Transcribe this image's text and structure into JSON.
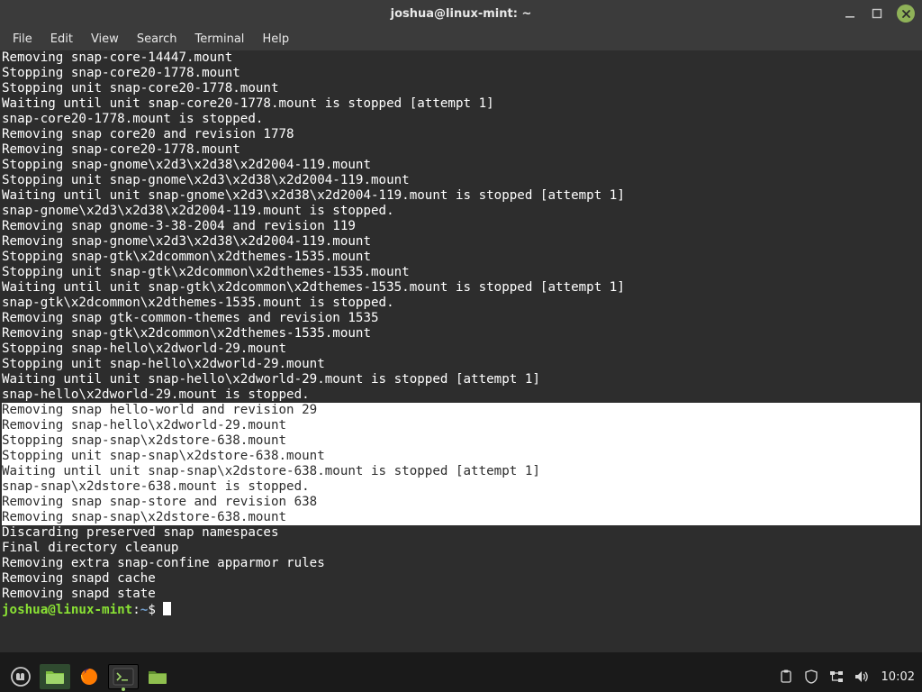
{
  "window": {
    "title": "joshua@linux-mint: ~"
  },
  "menubar": {
    "items": [
      "File",
      "Edit",
      "View",
      "Search",
      "Terminal",
      "Help"
    ]
  },
  "terminal": {
    "lines": [
      {
        "t": "Removing snap-core-14447.mount",
        "sel": false
      },
      {
        "t": "Stopping snap-core20-1778.mount",
        "sel": false
      },
      {
        "t": "Stopping unit snap-core20-1778.mount",
        "sel": false
      },
      {
        "t": "Waiting until unit snap-core20-1778.mount is stopped [attempt 1]",
        "sel": false
      },
      {
        "t": "snap-core20-1778.mount is stopped.",
        "sel": false
      },
      {
        "t": "Removing snap core20 and revision 1778",
        "sel": false
      },
      {
        "t": "Removing snap-core20-1778.mount",
        "sel": false
      },
      {
        "t": "Stopping snap-gnome\\x2d3\\x2d38\\x2d2004-119.mount",
        "sel": false
      },
      {
        "t": "Stopping unit snap-gnome\\x2d3\\x2d38\\x2d2004-119.mount",
        "sel": false
      },
      {
        "t": "Waiting until unit snap-gnome\\x2d3\\x2d38\\x2d2004-119.mount is stopped [attempt 1]",
        "sel": false
      },
      {
        "t": "snap-gnome\\x2d3\\x2d38\\x2d2004-119.mount is stopped.",
        "sel": false
      },
      {
        "t": "Removing snap gnome-3-38-2004 and revision 119",
        "sel": false
      },
      {
        "t": "Removing snap-gnome\\x2d3\\x2d38\\x2d2004-119.mount",
        "sel": false
      },
      {
        "t": "Stopping snap-gtk\\x2dcommon\\x2dthemes-1535.mount",
        "sel": false
      },
      {
        "t": "Stopping unit snap-gtk\\x2dcommon\\x2dthemes-1535.mount",
        "sel": false
      },
      {
        "t": "Waiting until unit snap-gtk\\x2dcommon\\x2dthemes-1535.mount is stopped [attempt 1]",
        "sel": false
      },
      {
        "t": "snap-gtk\\x2dcommon\\x2dthemes-1535.mount is stopped.",
        "sel": false
      },
      {
        "t": "Removing snap gtk-common-themes and revision 1535",
        "sel": false
      },
      {
        "t": "Removing snap-gtk\\x2dcommon\\x2dthemes-1535.mount",
        "sel": false
      },
      {
        "t": "Stopping snap-hello\\x2dworld-29.mount",
        "sel": false
      },
      {
        "t": "Stopping unit snap-hello\\x2dworld-29.mount",
        "sel": false
      },
      {
        "t": "Waiting until unit snap-hello\\x2dworld-29.mount is stopped [attempt 1]",
        "sel": false
      },
      {
        "t": "snap-hello\\x2dworld-29.mount is stopped.",
        "sel": false
      },
      {
        "t": "Removing snap hello-world and revision 29",
        "sel": true
      },
      {
        "t": "Removing snap-hello\\x2dworld-29.mount",
        "sel": true
      },
      {
        "t": "Stopping snap-snap\\x2dstore-638.mount",
        "sel": true
      },
      {
        "t": "Stopping unit snap-snap\\x2dstore-638.mount",
        "sel": true
      },
      {
        "t": "Waiting until unit snap-snap\\x2dstore-638.mount is stopped [attempt 1]",
        "sel": true
      },
      {
        "t": "snap-snap\\x2dstore-638.mount is stopped.",
        "sel": true
      },
      {
        "t": "Removing snap snap-store and revision 638",
        "sel": true
      },
      {
        "t": "Removing snap-snap\\x2dstore-638.mount",
        "sel": true
      },
      {
        "t": "Discarding preserved snap namespaces",
        "sel": false
      },
      {
        "t": "Final directory cleanup",
        "sel": false
      },
      {
        "t": "Removing extra snap-confine apparmor rules",
        "sel": false
      },
      {
        "t": "Removing snapd cache",
        "sel": false
      },
      {
        "t": "Removing snapd state",
        "sel": false
      }
    ],
    "prompt": {
      "user_host": "joshua@linux-mint",
      "path": "~",
      "symbol": "$"
    }
  },
  "panel": {
    "clock": "10:02"
  }
}
